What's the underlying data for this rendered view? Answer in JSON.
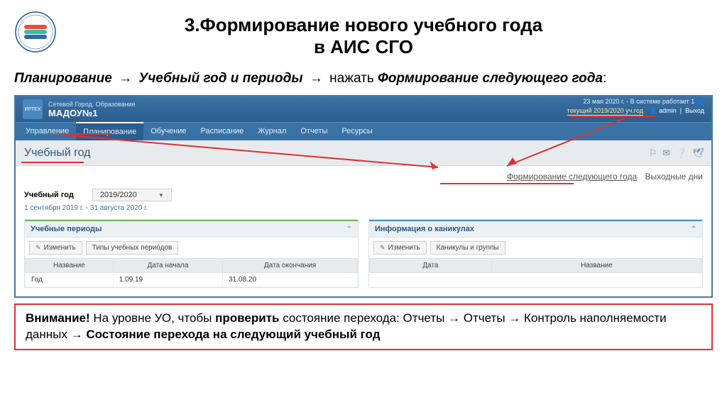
{
  "slide": {
    "title_l1": "3.Формирование нового учебного года",
    "title_l2": "в АИС СГО",
    "breadcrumb_bold1": "Планирование",
    "breadcrumb_bold2": "Учебный год и периоды",
    "breadcrumb_tail": " нажать ",
    "breadcrumb_ital": "Формирование следующего года",
    "arrow": "→"
  },
  "app": {
    "subtitle": "Сетевой Город. Образование",
    "name": "МАДОУ№1",
    "logo_label": "ИРТЕХ",
    "date_info": "23 мая 2020 г. - В системе работает 1",
    "year_highlight": "текущий 2019/2020 уч.год",
    "user": "admin",
    "exit": "Выход",
    "menu": [
      "Управление",
      "Планирование",
      "Обучение",
      "Расписание",
      "Журнал",
      "Отчеты",
      "Ресурсы"
    ],
    "sec_title": "Учебный год",
    "top_link1": "Формирование следующего года",
    "top_link2": "Выходные дни",
    "year_label": "Учебный год",
    "year_value": "2019/2020",
    "year_dates": "1 сентября 2019 г. - 31 августа 2020 г.",
    "panel1": {
      "title": "Учебные периоды",
      "btn1": "Изменить",
      "btn2": "Типы учебных периодов",
      "cols": [
        "Название",
        "Дата начала",
        "Дата окончания"
      ],
      "row": [
        "Год",
        "1.09.19",
        "31.08.20"
      ]
    },
    "panel2": {
      "title": "Информация о каникулах",
      "btn1": "Изменить",
      "btn2": "Каникулы и группы",
      "cols": [
        "Дата",
        "Название"
      ]
    },
    "user_icon": "👤",
    "people_icon": "👤"
  },
  "attention": {
    "lead": "Внимание!",
    "p1": " На уровне УО, чтобы ",
    "b1": "проверить",
    "p2": " состояние перехода: Отчеты ",
    "p3": " Отчеты ",
    "p4": " Контроль наполняемости данных ",
    "b2": "Состояние перехода на следующий учебный год"
  }
}
